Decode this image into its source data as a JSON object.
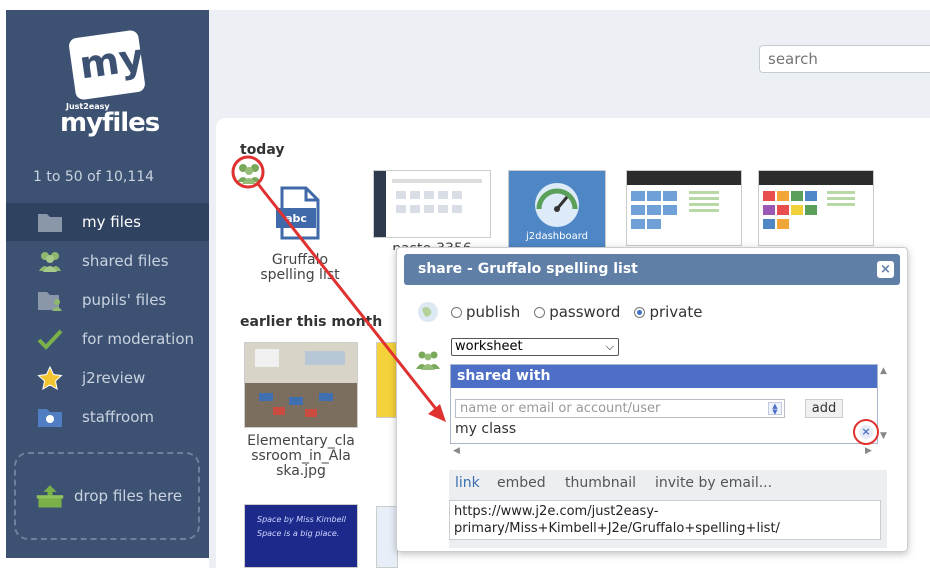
{
  "app": {
    "logo_badge": "my",
    "logo_small": "Just2easy",
    "logo_main": "myfiles"
  },
  "sidebar": {
    "file_count": "1 to 50 of 10,114",
    "items": [
      {
        "label": "my files",
        "icon": "folder-icon"
      },
      {
        "label": "shared files",
        "icon": "people-icon"
      },
      {
        "label": "pupils' files",
        "icon": "pupils-folder-icon"
      },
      {
        "label": "for moderation",
        "icon": "checkmark-icon"
      },
      {
        "label": "j2review",
        "icon": "star-icon"
      },
      {
        "label": "staffroom",
        "icon": "staffroom-icon"
      }
    ],
    "drop_label": "drop files here"
  },
  "search": {
    "placeholder": "search"
  },
  "main": {
    "today_title": "today",
    "earlier_title": "earlier this month",
    "files_today": [
      {
        "name": "Gruffalo spelling list",
        "line1": "Gruffalo",
        "line2": "spelling list"
      },
      {
        "name": "paste-3356",
        "line1": "paste-3356"
      },
      {
        "name": "j2dashboard",
        "line1": "j2dashboard"
      }
    ],
    "files_earlier": [
      {
        "line1": "Elementary_cla",
        "line2": "ssroom_in_Ala",
        "line3": "ska.jpg"
      }
    ],
    "thumb_dashboard_label": "j2dashboard",
    "space_text_1": "Space by Miss Kimbell",
    "space_text_2": "Space is a big place."
  },
  "dialog": {
    "title": "share - Gruffalo spelling list",
    "close": "×",
    "visibility_options": [
      {
        "label": "publish",
        "selected": false
      },
      {
        "label": "password",
        "selected": false
      },
      {
        "label": "private",
        "selected": true
      }
    ],
    "type_select": "worksheet",
    "shared_with_title": "shared with",
    "input_placeholder": "name or email or account/user",
    "add_label": "add",
    "entry": "my class",
    "remove": "×",
    "tabs": [
      "link",
      "embed",
      "thumbnail",
      "invite by email..."
    ],
    "active_tab": "link",
    "link_line1": "https://www.j2e.com/just2easy-",
    "link_line2": "primary/Miss+Kimbell+J2e/Gruffalo+spelling+list/"
  },
  "colors": {
    "sidebar_bg": "#3d5272",
    "dialog_header": "#5f7fa7",
    "shared_header": "#4d6fc5",
    "annotation_red": "#e03131"
  }
}
